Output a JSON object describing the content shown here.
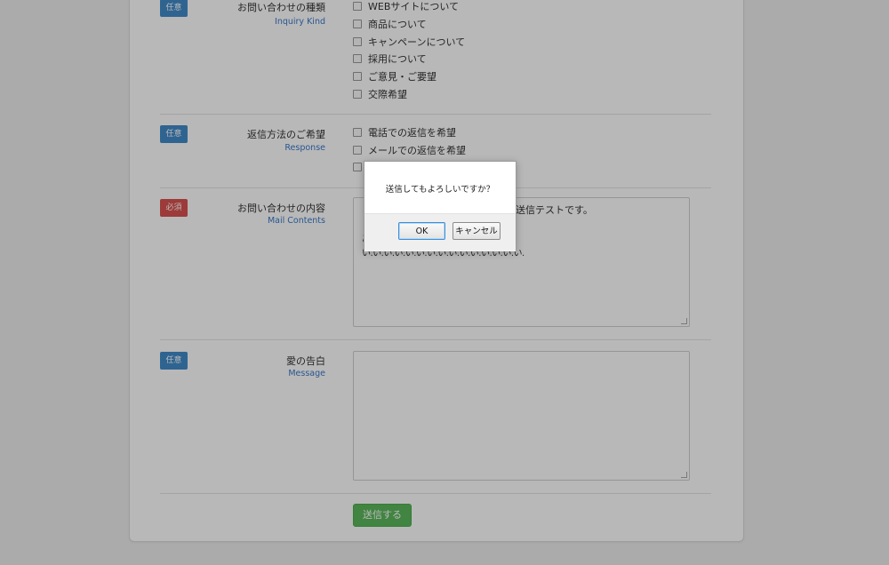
{
  "form": {
    "inquiry_kind": {
      "badge": "任意",
      "label_jp": "お問い合わせの種類",
      "label_en": "Inquiry Kind",
      "options": [
        "WEBサイトについて",
        "商品について",
        "キャンペーンについて",
        "採用について",
        "ご意見・ご要望",
        "交際希望"
      ]
    },
    "response": {
      "badge": "任意",
      "label_jp": "返信方法のご希望",
      "label_en": "Response",
      "options": [
        "電話での返信を希望",
        "メールでの返信を希望"
      ]
    },
    "mail_contents": {
      "badge": "必須",
      "label_jp": "お問い合わせの内容",
      "label_en": "Mail Contents",
      "visible_text": {
        "line1_start": "こ",
        "line1_end": "送信テストです。",
        "line2_start": "あ",
        "line3": "い.い.い.い.い.い.い.い.い.い.い.い.い.い.い."
      }
    },
    "message": {
      "badge": "任意",
      "label_jp": "愛の告白",
      "label_en": "Message"
    },
    "submit_label": "送信する"
  },
  "dialog": {
    "message": "送信してもよろしいですか？",
    "ok_label": "OK",
    "cancel_label": "キャンセル"
  },
  "colors": {
    "optional_badge": "#428bca",
    "required_badge": "#d9534f",
    "submit": "#5cb85c",
    "label_en": "#3a78c8"
  }
}
